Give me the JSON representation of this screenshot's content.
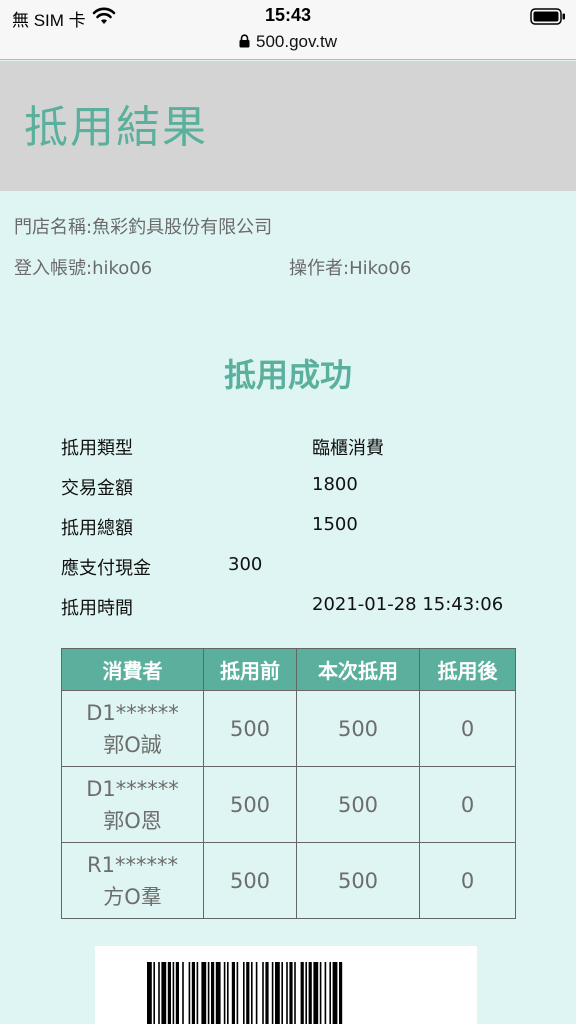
{
  "status": {
    "carrier": "無 SIM 卡",
    "time": "15:43",
    "url": "500.gov.tw"
  },
  "page": {
    "title": "抵用結果",
    "store": "門店名稱:魚彩釣具股份有限公司",
    "login": "登入帳號:hiko06",
    "operator": "操作者:Hiko06",
    "success": "抵用成功"
  },
  "info": {
    "type_label": "抵用類型",
    "type_value": "臨櫃消費",
    "amount_label": "交易金額",
    "amount_value": "1800",
    "total_label": "抵用總額",
    "total_value": "1500",
    "cash_label": "應支付現金",
    "cash_value": "300",
    "time_label": "抵用時間",
    "time_value": "2021-01-28 15:43:06"
  },
  "table": {
    "headers": [
      "消費者",
      "抵用前",
      "本次抵用",
      "抵用後"
    ],
    "rows": [
      {
        "id": "D1******",
        "name": "郭O誠",
        "before": "500",
        "used": "500",
        "after": "0"
      },
      {
        "id": "D1******",
        "name": "郭O恩",
        "before": "500",
        "used": "500",
        "after": "0"
      },
      {
        "id": "R1******",
        "name": "方O羣",
        "before": "500",
        "used": "500",
        "after": "0"
      }
    ]
  },
  "colors": {
    "accent": "#5bb09d",
    "background": "#dff5f3",
    "header_bg": "#d4d4d4"
  }
}
